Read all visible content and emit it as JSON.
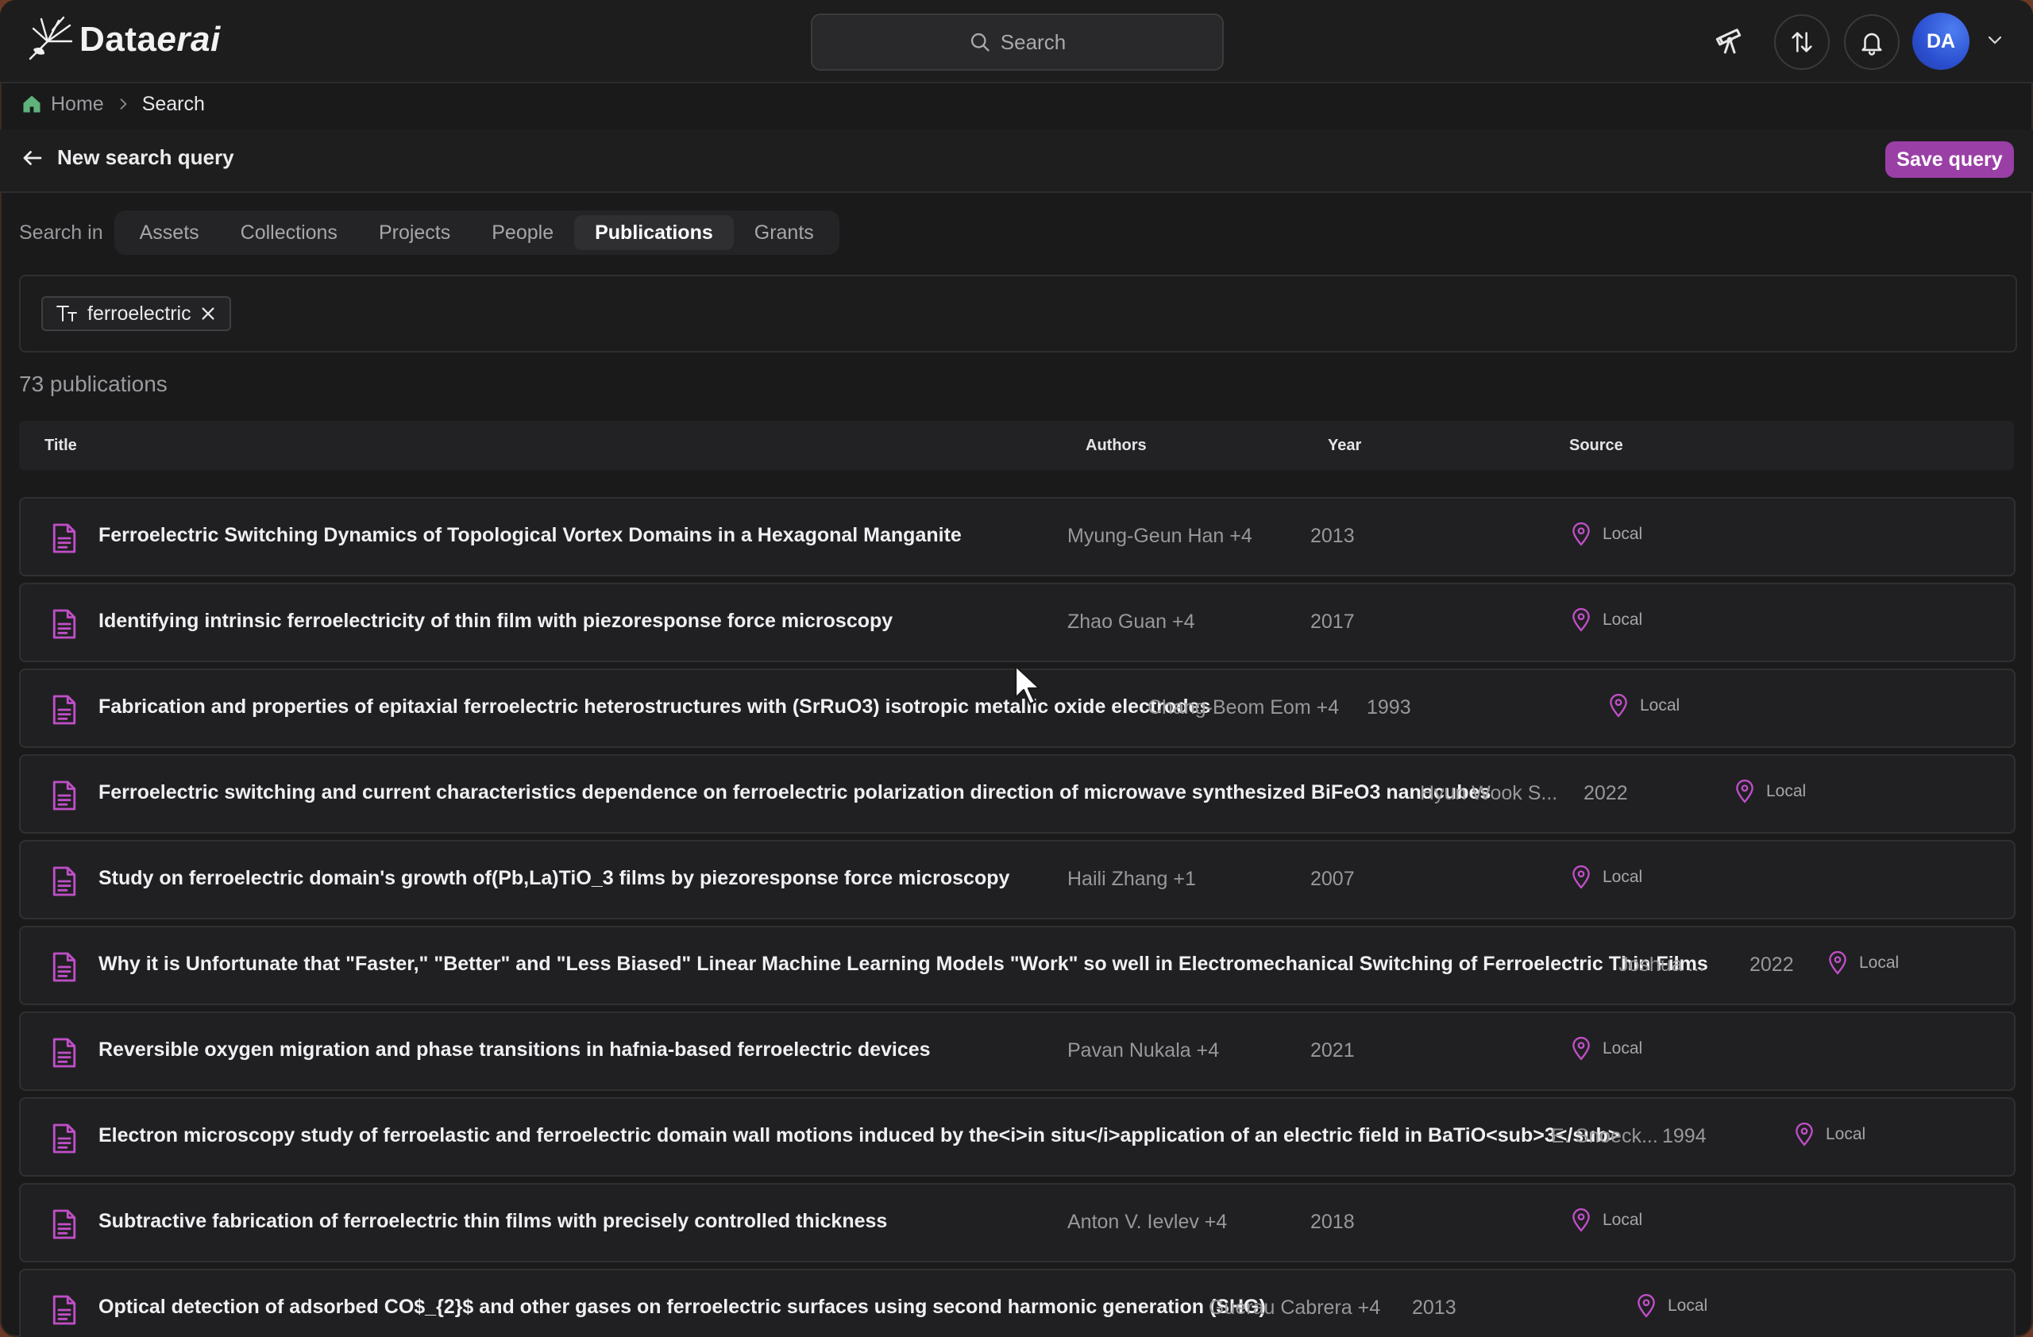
{
  "app": {
    "name_prefix": "Data",
    "name_suffix": "erai"
  },
  "header": {
    "search_placeholder": "Search",
    "avatar_initials": "DA"
  },
  "breadcrumb": {
    "home": "Home",
    "current": "Search"
  },
  "subheader": {
    "back_label": "New search query",
    "save_label": "Save query"
  },
  "search_in": {
    "label": "Search in",
    "tabs": [
      "Assets",
      "Collections",
      "Projects",
      "People",
      "Publications",
      "Grants"
    ],
    "active": "Publications"
  },
  "filter": {
    "chip_label": "ferroelectric"
  },
  "results": {
    "count_text": "73 publications",
    "columns": [
      "Title",
      "Authors",
      "Year",
      "Source"
    ],
    "rows": [
      {
        "title": "Ferroelectric Switching Dynamics of Topological Vortex Domains in a Hexagonal Manganite",
        "authors": "Myung-Geun Han +4",
        "year": "2013",
        "source": "Local"
      },
      {
        "title": "Identifying intrinsic ferroelectricity of thin film with piezoresponse force microscopy",
        "authors": "Zhao Guan +4",
        "year": "2017",
        "source": "Local"
      },
      {
        "title": "Fabrication and properties of epitaxial ferroelectric heterostructures with (SrRuO3) isotropic metallic oxide electrodes",
        "authors": "Chang-Beom Eom +4",
        "year": "1993",
        "source": "Local"
      },
      {
        "title": "Ferroelectric switching and current characteristics dependence on ferroelectric polarization direction of microwave synthesized BiFeO3 nanocubes",
        "authors": "Hyun Wook S...",
        "year": "2022",
        "source": "Local"
      },
      {
        "title": "Study on ferroelectric domain's growth of(Pb,La)TiO_3 films by piezoresponse force microscopy",
        "authors": "Haili Zhang +1",
        "year": "2007",
        "source": "Local"
      },
      {
        "title": "Why it is Unfortunate that \"Faster,\" \"Better\" and \"Less Biased\" Linear Machine Learning Models \"Work\" so well in Electromechanical Switching of Ferroelectric Thin Films",
        "authors": "Joshua ...",
        "year": "2022",
        "source": "Local"
      },
      {
        "title": "Reversible oxygen migration and phase transitions in hafnia-based ferroelectric devices",
        "authors": "Pavan Nukala +4",
        "year": "2021",
        "source": "Local"
      },
      {
        "title": "Electron microscopy study of ferroelastic and ferroelectric domain wall motions induced by the<i>in situ</i>application of an electric field in BaTiO<sub>3</sub>",
        "authors": "E. Snoeck...",
        "year": "1994",
        "source": "Local"
      },
      {
        "title": "Subtractive fabrication of ferroelectric thin films with precisely controlled thickness",
        "authors": "Anton V. Ievlev +4",
        "year": "2018",
        "source": "Local"
      },
      {
        "title": "Optical detection of adsorbed CO$_{2}$ and other gases on ferroelectric surfaces using second harmonic generation (SHG)",
        "authors": "Guerau Cabrera +4",
        "year": "2013",
        "source": "Local"
      }
    ]
  },
  "colors": {
    "accent": "#9a3fa6",
    "icon_pink": "#c04fc8",
    "avatar_blue": "#2b4fd0"
  }
}
